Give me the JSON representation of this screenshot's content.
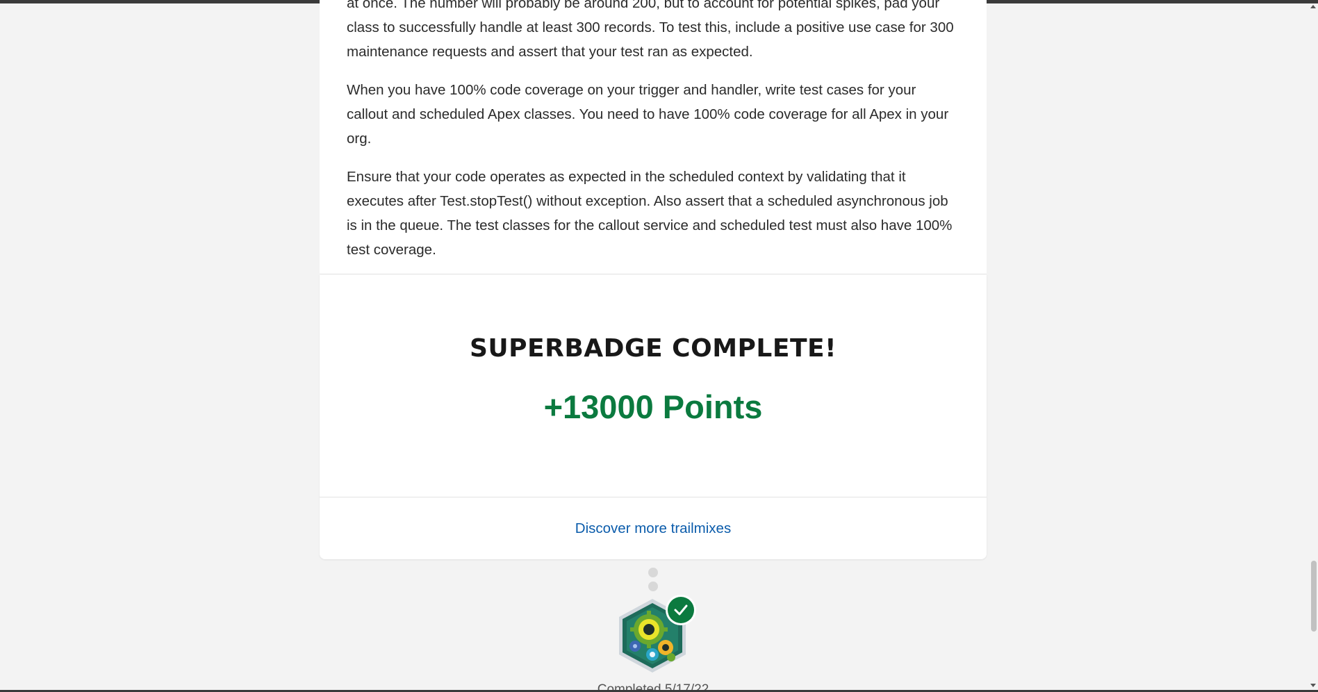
{
  "instructions": {
    "paragraphs": [
      "at once. The number will probably be around 200, but to account for potential spikes, pad your class to successfully handle at least 300 records. To test this, include a positive use case for 300 maintenance requests and assert that your test ran as expected.",
      "When you have 100% code coverage on your trigger and handler, write test cases for your callout and scheduled Apex classes. You need to have 100% code coverage for all Apex in your org.",
      "Ensure that your code operates as expected in the scheduled context by validating that it executes after Test.stopTest() without exception. Also assert that a scheduled asynchronous job is in the queue. The test classes for the callout service and scheduled test must also have 100% test coverage."
    ]
  },
  "completion": {
    "title": "Superbadge Complete!",
    "points": "+13000 Points",
    "discover_link": "Discover more trailmixes"
  },
  "badge": {
    "icon": "superbadge-gears-icon",
    "status_icon": "checkmark-icon",
    "completed_label": "Completed 5/17/22"
  },
  "colors": {
    "points_green": "#0b7a3f",
    "link_blue": "#0b5cab",
    "check_green": "#0b7a3f"
  }
}
